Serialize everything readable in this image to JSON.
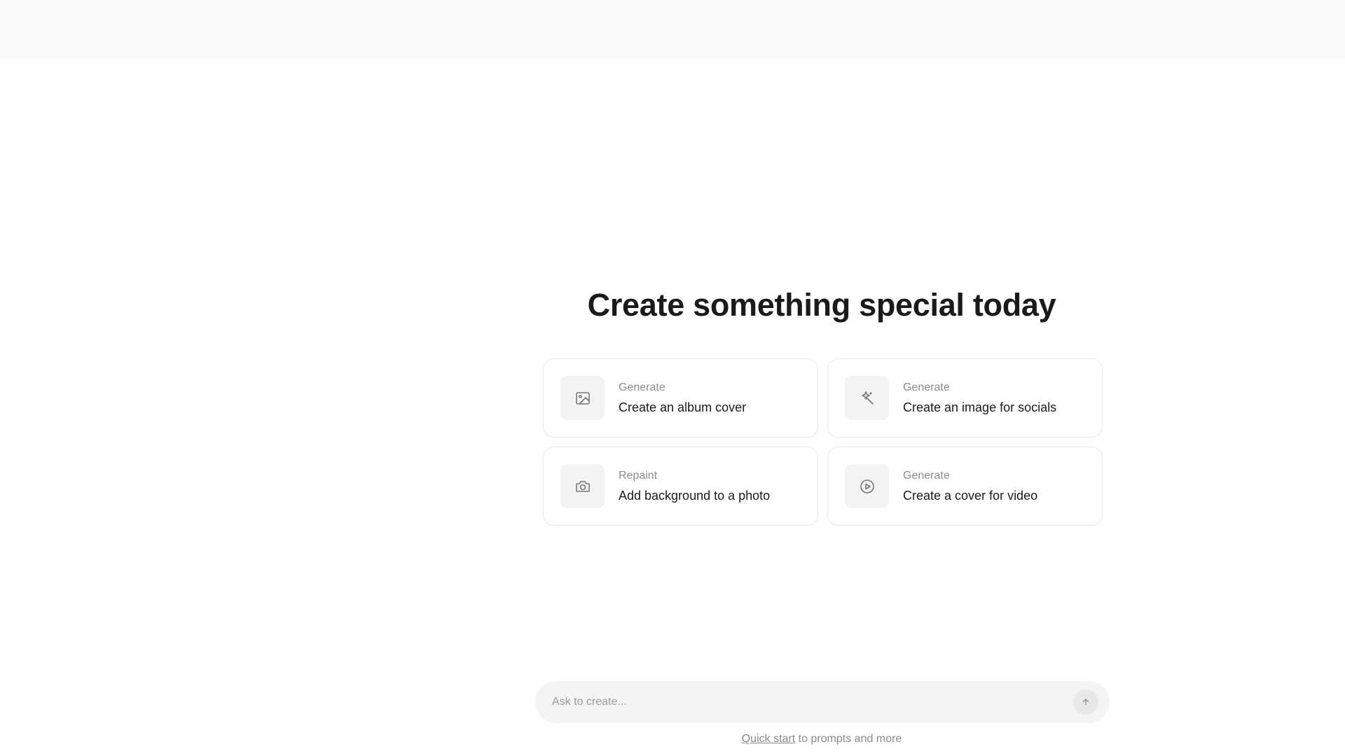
{
  "header": {},
  "main": {
    "title": "Create something special today",
    "cards": [
      {
        "category": "Generate",
        "label": "Create an album cover",
        "icon": "image-icon"
      },
      {
        "category": "Generate",
        "label": "Create an image for socials",
        "icon": "magic-wand-icon"
      },
      {
        "category": "Repaint",
        "label": "Add background to a photo",
        "icon": "camera-icon"
      },
      {
        "category": "Generate",
        "label": "Create a cover for video",
        "icon": "play-circle-icon"
      }
    ]
  },
  "prompt": {
    "placeholder": "Ask to create..."
  },
  "footer": {
    "link_text": "Quick start",
    "hint_text": " to prompts and more"
  },
  "colors": {
    "top_bar": "#fafafa",
    "card_border": "#ebebeb",
    "icon_tile": "#f3f3f3",
    "prompt_bg": "#f4f4f4",
    "muted_text": "#8a8a8a",
    "primary_text": "#1a1a1a"
  }
}
